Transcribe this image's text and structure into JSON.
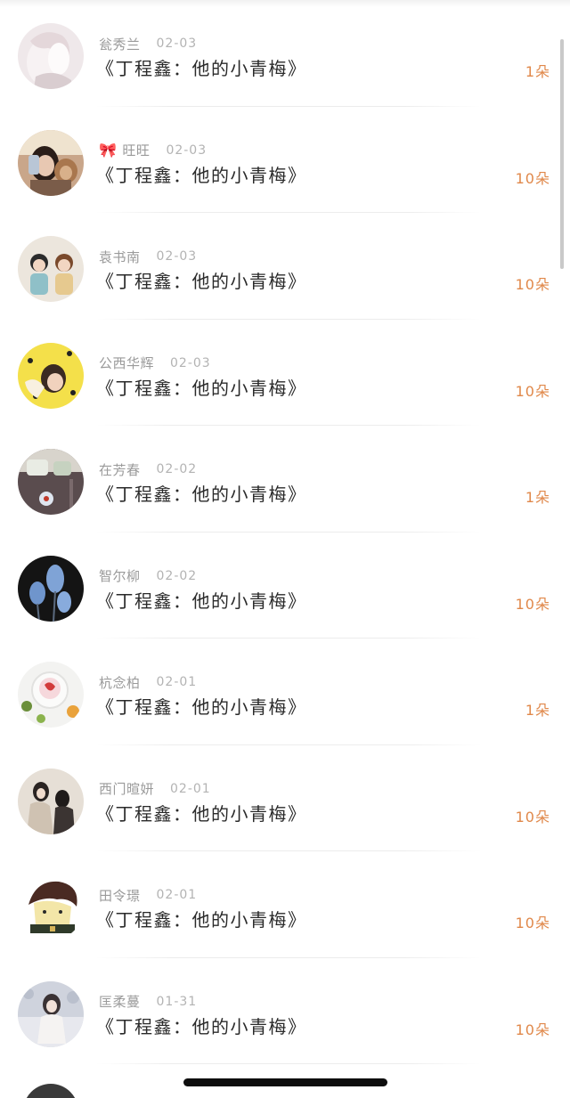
{
  "rows": [
    {
      "name": "瓮秀兰",
      "date": "02-03",
      "title": "《丁程鑫：他的小青梅》",
      "gift": "1朵",
      "bow": false
    },
    {
      "name": "旺旺",
      "date": "02-03",
      "title": "《丁程鑫：他的小青梅》",
      "gift": "10朵",
      "bow": true
    },
    {
      "name": "袁书南",
      "date": "02-03",
      "title": "《丁程鑫：他的小青梅》",
      "gift": "10朵",
      "bow": false
    },
    {
      "name": "公西华辉",
      "date": "02-03",
      "title": "《丁程鑫：他的小青梅》",
      "gift": "10朵",
      "bow": false
    },
    {
      "name": "在芳春",
      "date": "02-02",
      "title": "《丁程鑫：他的小青梅》",
      "gift": "1朵",
      "bow": false
    },
    {
      "name": "智尔柳",
      "date": "02-02",
      "title": "《丁程鑫：他的小青梅》",
      "gift": "10朵",
      "bow": false
    },
    {
      "name": "杭念柏",
      "date": "02-01",
      "title": "《丁程鑫：他的小青梅》",
      "gift": "1朵",
      "bow": false
    },
    {
      "name": "西门暄妍",
      "date": "02-01",
      "title": "《丁程鑫：他的小青梅》",
      "gift": "10朵",
      "bow": false
    },
    {
      "name": "田令璟",
      "date": "02-01",
      "title": "《丁程鑫：他的小青梅》",
      "gift": "10朵",
      "bow": false
    },
    {
      "name": "匡柔蔓",
      "date": "01-31",
      "title": "《丁程鑫：他的小青梅》",
      "gift": "10朵",
      "bow": false
    }
  ],
  "bow_glyph": "🎀",
  "colors": {
    "gift_accent": "#e0884a",
    "name_gray": "#9a9a9a",
    "title_text": "#2a2a2a"
  }
}
